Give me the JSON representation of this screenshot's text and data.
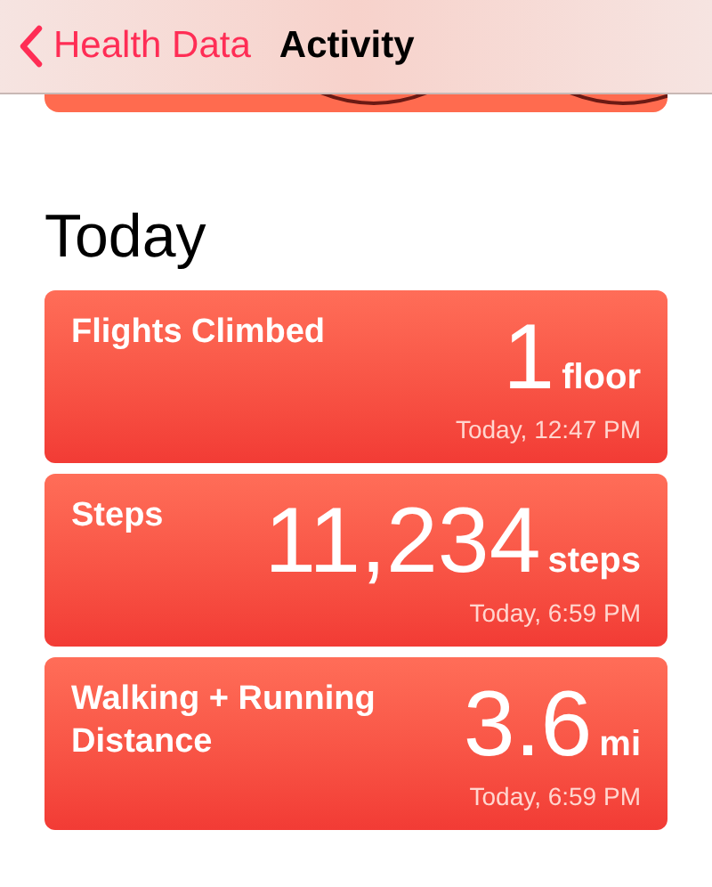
{
  "nav": {
    "back_label": "Health Data",
    "title": "Activity"
  },
  "section_title": "Today",
  "cards": [
    {
      "label": "Flights Climbed",
      "value": "1",
      "unit": "floor",
      "timestamp": "Today, 12:47 PM"
    },
    {
      "label": "Steps",
      "value": "11,234",
      "unit": "steps",
      "timestamp": "Today, 6:59 PM"
    },
    {
      "label": "Walking + Running Distance",
      "value": "3.6",
      "unit": "mi",
      "timestamp": "Today, 6:59 PM"
    }
  ]
}
